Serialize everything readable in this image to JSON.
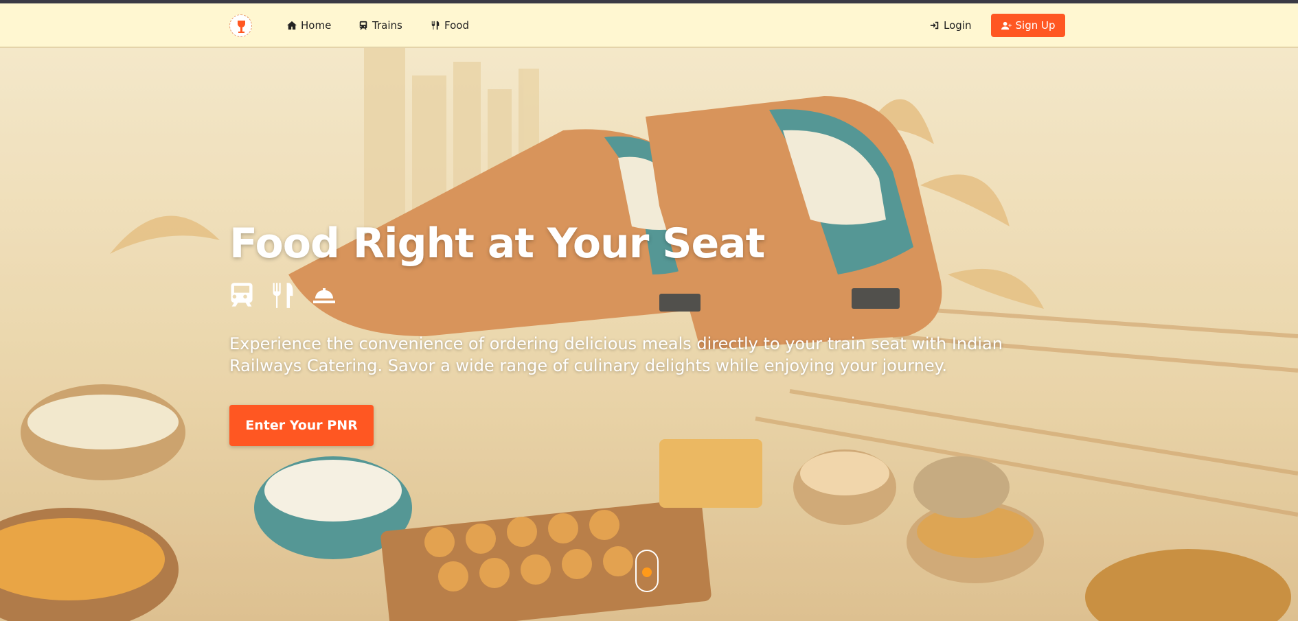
{
  "nav": {
    "logo": {
      "icon": "trophy-cup-icon",
      "alt": ""
    },
    "links": [
      {
        "label": "Home",
        "icon": "home-icon"
      },
      {
        "label": "Trains",
        "icon": "train-icon"
      },
      {
        "label": "Food",
        "icon": "utensils-icon"
      }
    ],
    "login_label": "Login",
    "signup_label": "Sign Up"
  },
  "hero": {
    "title": "Food Right at Your Seat",
    "icons": [
      "train-icon",
      "utensils-icon",
      "concierge-bell-icon"
    ],
    "description": "Experience the convenience of ordering delicious meals directly to your train seat with Indian Railways Catering. Savor a wide range of culinary delights while enjoying your journey.",
    "cta_label": "Enter Your PNR"
  },
  "colors": {
    "accent": "#ff5722",
    "navbar_bg": "#fff7d1",
    "scroll_dot": "#ff9a1a"
  }
}
